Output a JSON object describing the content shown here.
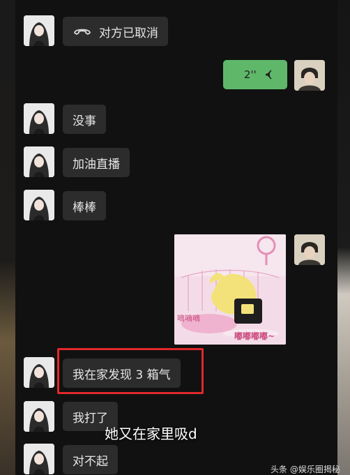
{
  "messages": {
    "call_status": "对方已取消",
    "voice_duration": "2''",
    "m1": "没事",
    "m2": "加油直播",
    "m3": "棒棒",
    "sticker_text_a": "嘀嘀嘀",
    "sticker_text_b": "嘟嘟嘟嘟~",
    "m4": "我在家发现 3 箱气",
    "m5": "我打了",
    "m6": "对不起"
  },
  "subtitle": "她又在家里吸d",
  "watermark": "头条 @娱乐圈揭秘",
  "colors": {
    "outgoing_bubble": "#5fb86a",
    "incoming_bubble": "#2c2c2c",
    "highlight_border": "#e0282a"
  }
}
